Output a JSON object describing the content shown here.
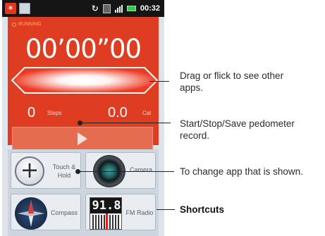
{
  "status_bar": {
    "time": "00:32",
    "icons": [
      "run-icon",
      "picture-icon",
      "sync-icon",
      "sd-card-icon",
      "signal-icon",
      "battery-icon"
    ]
  },
  "pedometer": {
    "status_label": "RUNNING",
    "timer": "00’00”00",
    "steps_value": "0",
    "steps_label": "Steps",
    "cal_value": "0.0",
    "cal_label": "Cal"
  },
  "shortcut_tiles": [
    {
      "label": "Touch &\nHold",
      "icon": "plus-icon"
    },
    {
      "label": "Camera",
      "icon": "camera-icon"
    },
    {
      "label": "Compass",
      "icon": "compass-icon"
    },
    {
      "label": "FM Radio",
      "icon": "fm-radio-icon",
      "display": "91.8"
    }
  ],
  "callouts": {
    "flick": "Drag or flick to see other\napps.",
    "startstop": "Start/Stop/Save pedometer\nrecord.",
    "change_app": "To change app that is shown.",
    "shortcuts": "Shortcuts"
  },
  "colors": {
    "pedometer_red": "#de3d22",
    "status_bar": "#151515",
    "grid_bg": "#cdd5de"
  }
}
